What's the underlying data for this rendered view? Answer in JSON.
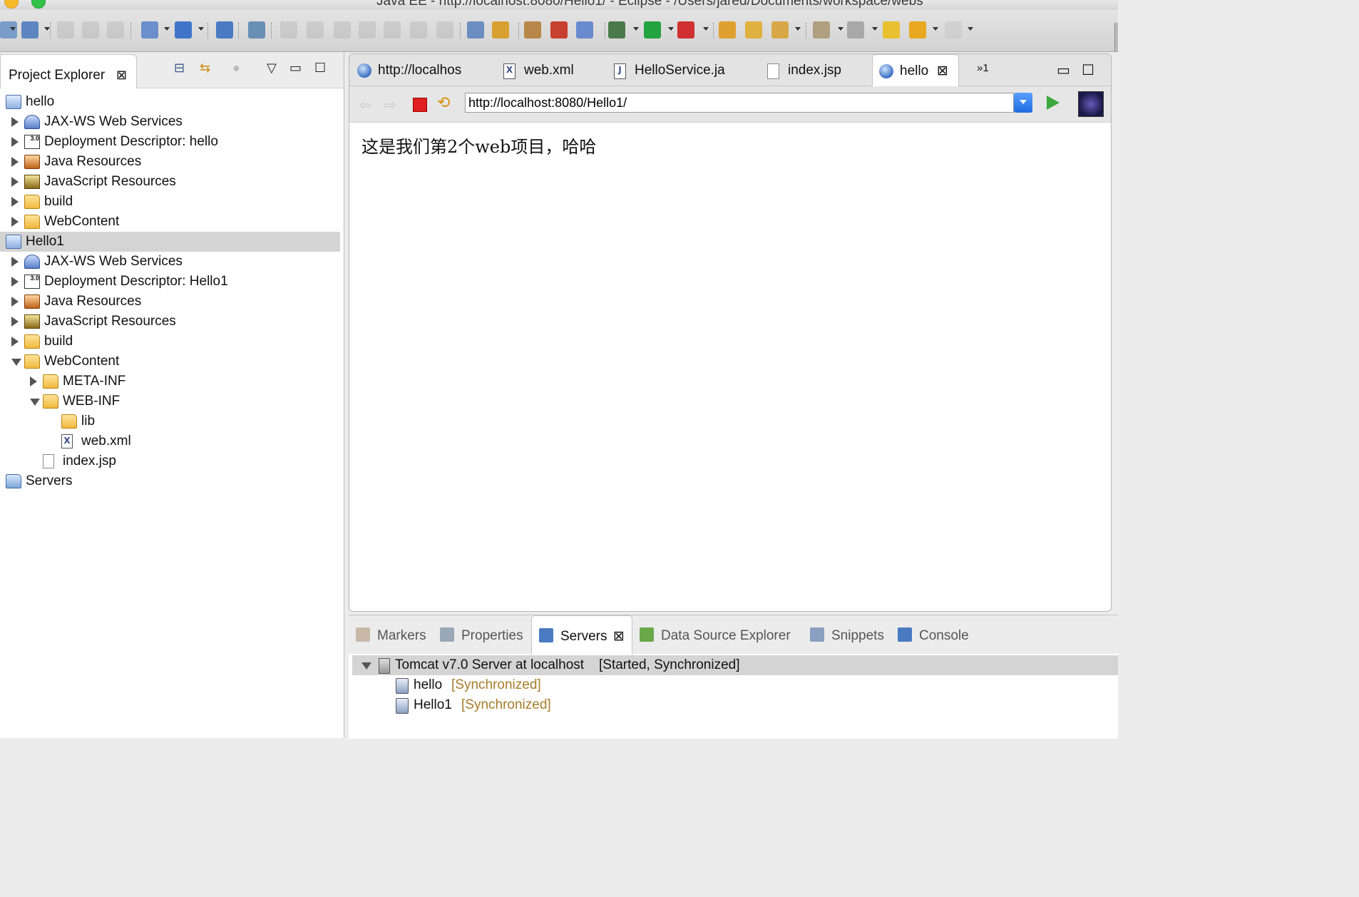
{
  "window": {
    "title": "Java EE - http://localhost:8080/Hello1/ - Eclipse - /Users/jared/Documents/workspace/webs"
  },
  "colors": {
    "accent": "#1e6ae0",
    "selection": "#d4d4d4",
    "sync_label": "#a67c2a"
  },
  "toolbar": {
    "icons": [
      "new-wizard-icon",
      "new-icon",
      "save-icon",
      "save-all-icon",
      "print-icon",
      "new-server-icon",
      "new-web-service-icon",
      "globe-icon",
      "disconnect-icon",
      "resume-icon",
      "suspend-icon",
      "terminate-icon",
      "disconnect-debug-icon",
      "step-into-icon",
      "step-over-icon",
      "step-return-icon",
      "tasks-icon",
      "skip-icon",
      "tomcat-start-icon",
      "tomcat-stop-icon",
      "tomcat-restart-icon",
      "debug-icon",
      "run-icon",
      "run-external-icon",
      "open-type-icon",
      "open-folder-icon",
      "brush-icon",
      "annotation-next-icon",
      "annotation-prev-icon",
      "last-edit-icon",
      "back-icon",
      "forward-icon"
    ]
  },
  "project_explorer": {
    "tab_label": "Project Explorer",
    "tree": [
      {
        "label": "hello",
        "icon": "project-icon",
        "level": 0,
        "twisty": "none"
      },
      {
        "label": "JAX-WS Web Services",
        "icon": "jaxws-icon",
        "level": 1,
        "twisty": "collapsed"
      },
      {
        "label": "Deployment Descriptor: hello",
        "icon": "deployment-descriptor-icon",
        "level": 1,
        "twisty": "collapsed"
      },
      {
        "label": "Java Resources",
        "icon": "java-resources-icon",
        "level": 1,
        "twisty": "collapsed"
      },
      {
        "label": "JavaScript Resources",
        "icon": "javascript-resources-icon",
        "level": 1,
        "twisty": "collapsed"
      },
      {
        "label": "build",
        "icon": "folder-icon",
        "level": 1,
        "twisty": "collapsed"
      },
      {
        "label": "WebContent",
        "icon": "folder-icon",
        "level": 1,
        "twisty": "collapsed"
      },
      {
        "label": "Hello1",
        "icon": "project-icon",
        "level": 0,
        "twisty": "none",
        "selected": true
      },
      {
        "label": "JAX-WS Web Services",
        "icon": "jaxws-icon",
        "level": 1,
        "twisty": "collapsed"
      },
      {
        "label": "Deployment Descriptor: Hello1",
        "icon": "deployment-descriptor-icon",
        "level": 1,
        "twisty": "collapsed"
      },
      {
        "label": "Java Resources",
        "icon": "java-resources-icon",
        "level": 1,
        "twisty": "collapsed"
      },
      {
        "label": "JavaScript Resources",
        "icon": "javascript-resources-icon",
        "level": 1,
        "twisty": "collapsed"
      },
      {
        "label": "build",
        "icon": "folder-icon",
        "level": 1,
        "twisty": "collapsed"
      },
      {
        "label": "WebContent",
        "icon": "folder-icon",
        "level": 1,
        "twisty": "expanded"
      },
      {
        "label": "META-INF",
        "icon": "folder-icon",
        "level": 2,
        "twisty": "collapsed"
      },
      {
        "label": "WEB-INF",
        "icon": "folder-icon",
        "level": 2,
        "twisty": "expanded"
      },
      {
        "label": "lib",
        "icon": "folder-icon",
        "level": 3,
        "twisty": "none"
      },
      {
        "label": "web.xml",
        "icon": "xml-file-icon",
        "level": 3,
        "twisty": "none"
      },
      {
        "label": "index.jsp",
        "icon": "jsp-file-icon",
        "level": 2,
        "twisty": "none"
      },
      {
        "label": "Servers",
        "icon": "servers-folder-icon",
        "level": 0,
        "twisty": "none"
      }
    ]
  },
  "editor": {
    "tabs": [
      {
        "label": "http://localhos",
        "icon": "globe-icon",
        "active": false
      },
      {
        "label": "web.xml",
        "icon": "xml-file-icon",
        "active": false
      },
      {
        "label": "HelloService.ja",
        "icon": "java-file-icon",
        "active": false
      },
      {
        "label": "index.jsp",
        "icon": "jsp-file-icon",
        "active": false
      },
      {
        "label": "hello",
        "icon": "globe-icon",
        "active": true
      }
    ],
    "overflow_count": "1",
    "url": "http://localhost:8080/Hello1/",
    "page_text": "这是我们第2个web项目，哈哈"
  },
  "bottom_panel": {
    "tabs": [
      {
        "label": "Markers",
        "icon": "markers-icon",
        "active": false
      },
      {
        "label": "Properties",
        "icon": "properties-icon",
        "active": false
      },
      {
        "label": "Servers",
        "icon": "servers-icon",
        "active": true
      },
      {
        "label": "Data Source Explorer",
        "icon": "data-source-icon",
        "active": false
      },
      {
        "label": "Snippets",
        "icon": "snippets-icon",
        "active": false
      },
      {
        "label": "Console",
        "icon": "console-icon",
        "active": false
      }
    ],
    "servers": {
      "name": "Tomcat v7.0 Server at localhost",
      "status": "[Started, Synchronized]",
      "modules": [
        {
          "name": "hello",
          "status": "[Synchronized]"
        },
        {
          "name": "Hello1",
          "status": "[Synchronized]"
        }
      ]
    }
  }
}
